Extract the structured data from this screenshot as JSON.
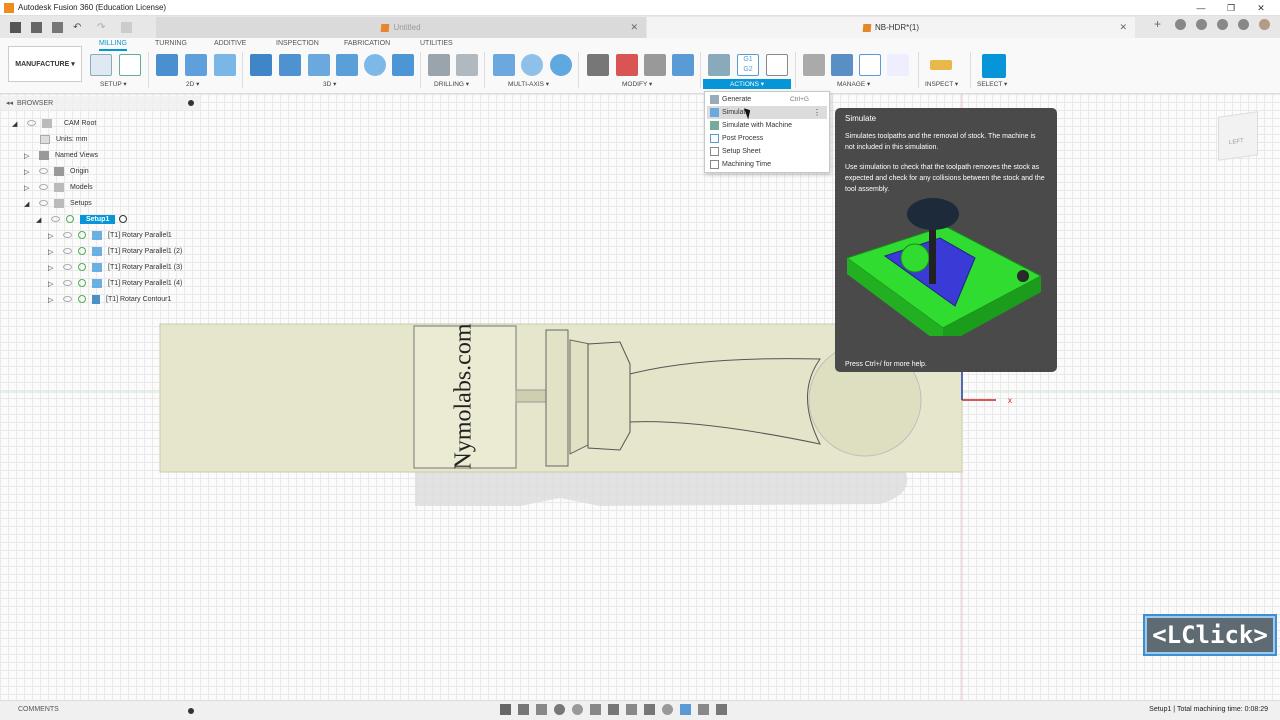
{
  "window": {
    "title": "Autodesk Fusion 360 (Education License)"
  },
  "tabs": [
    {
      "label": "Untitled",
      "active": false
    },
    {
      "label": "NB-HDR*(1)",
      "active": true
    }
  ],
  "workspace": {
    "label": "MANUFACTURE ▾"
  },
  "ribbon_tabs": [
    "MILLING",
    "TURNING",
    "ADDITIVE",
    "INSPECTION",
    "FABRICATION",
    "UTILITIES"
  ],
  "groups": {
    "setup": "SETUP ▾",
    "twod": "2D ▾",
    "threed": "3D ▾",
    "drilling": "DRILLING ▾",
    "multiaxis": "MULTI-AXIS ▾",
    "modify": "MODIFY ▾",
    "actions": "ACTIONS ▾",
    "manage": "MANAGE ▾",
    "inspect": "INSPECT ▾",
    "select": "SELECT ▾"
  },
  "browser": {
    "title": "BROWSER",
    "items": [
      {
        "label": "CAM Root"
      },
      {
        "label": "Units: mm"
      },
      {
        "label": "Named Views"
      },
      {
        "label": "Origin"
      },
      {
        "label": "Models"
      },
      {
        "label": "Setups"
      },
      {
        "label": "Setup1"
      },
      {
        "label": "[T1] Rotary Parallel1"
      },
      {
        "label": "[T1] Rotary Parallel1 (2)"
      },
      {
        "label": "[T1] Rotary Parallel1 (3)"
      },
      {
        "label": "[T1] Rotary Parallel1 (4)"
      },
      {
        "label": "[T1] Rotary Contour1"
      }
    ]
  },
  "actions_menu": [
    {
      "label": "Generate",
      "shortcut": "Ctrl+G"
    },
    {
      "label": "Simulate",
      "shortcut": ""
    },
    {
      "label": "Simulate with Machine",
      "shortcut": ""
    },
    {
      "label": "Post Process",
      "shortcut": ""
    },
    {
      "label": "Setup Sheet",
      "shortcut": ""
    },
    {
      "label": "Machining Time",
      "shortcut": ""
    }
  ],
  "tooltip": {
    "title": "Simulate",
    "p1": "Simulates toolpaths and the removal of stock. The machine is not included in this simulation.",
    "p2": "Use simulation to check that the toolpath removes the stock as expected and check for any collisions between the stock and the tool assembly.",
    "help": "Press Ctrl+/ for more help."
  },
  "model": {
    "engraving": "Nymolabs.com"
  },
  "viewcube": {
    "face": "LEFT"
  },
  "overlay": {
    "label": "<LClick>"
  },
  "status": {
    "comments": "COMMENTS",
    "text": "Setup1 | Total machining time: 0:08:29"
  },
  "colors": {
    "accent": "#0696d7",
    "stock": "#e6e6cc",
    "tooltip_bg": "#4a4a4a"
  }
}
